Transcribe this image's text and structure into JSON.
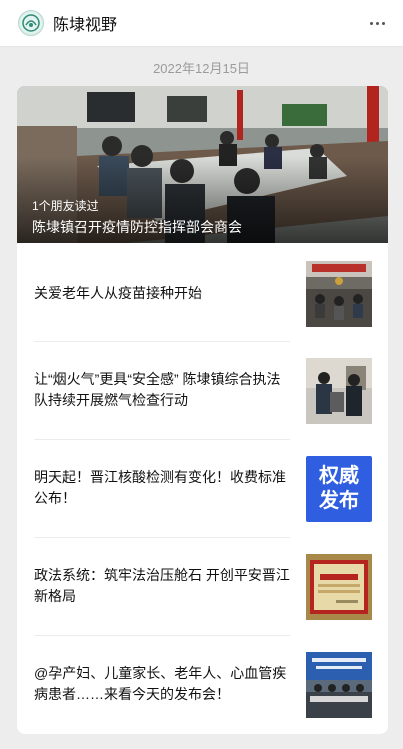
{
  "header": {
    "account_name": "陈埭视野",
    "avatar_icon": "account-logo-icon",
    "more_icon": "more-dots-icon"
  },
  "date": "2022年12月15日",
  "hero": {
    "read_by": "1个朋友读过",
    "title": "陈埭镇召开疫情防控指挥部会商会"
  },
  "articles": [
    {
      "title": "关爱老年人从疫苗接种开始"
    },
    {
      "title": "让“烟火气”更具“安全感” 陈埭镇综合执法队持续开展燃气检查行动"
    },
    {
      "title": "明天起！晋江核酸检测有变化！收费标准公布！",
      "thumb_text": [
        "权威",
        "发布"
      ]
    },
    {
      "title": "政法系统：筑牢法治压舱石 开创平安晋江新格局"
    },
    {
      "title": "@孕产妇、儿童家长、老年人、心血管疾病患者……来看今天的发布会！"
    }
  ]
}
